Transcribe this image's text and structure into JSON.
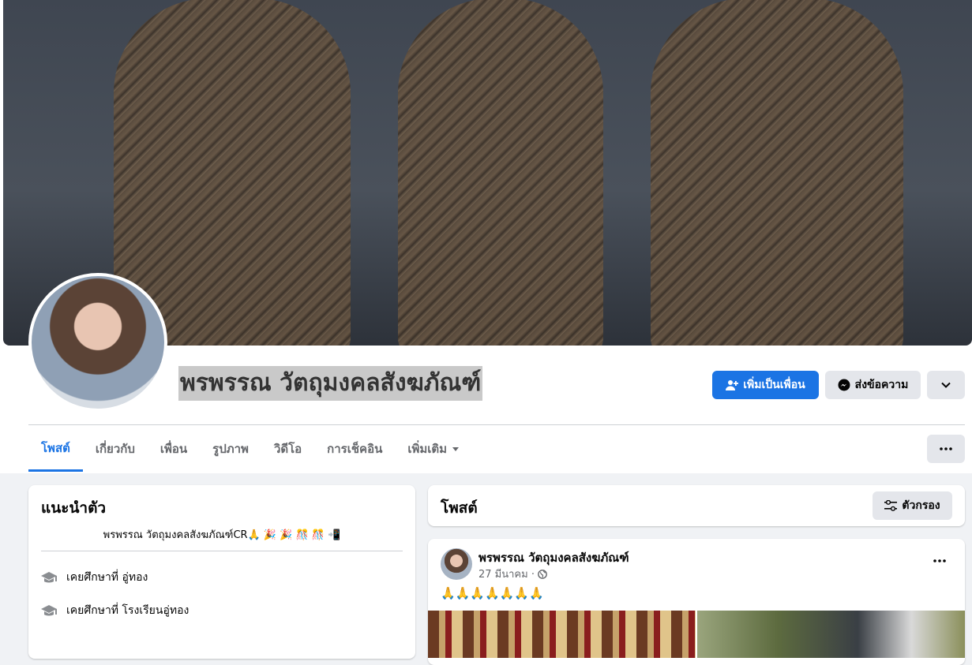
{
  "profile": {
    "name": "พรพรรณ วัตถุมงคลสังฆภัณฑ์"
  },
  "actions": {
    "add_friend": "เพิ่มเป็นเพื่อน",
    "message": "ส่งข้อความ"
  },
  "tabs": [
    {
      "label": "โพสต์",
      "active": true
    },
    {
      "label": "เกี่ยวกับ"
    },
    {
      "label": "เพื่อน"
    },
    {
      "label": "รูปภาพ"
    },
    {
      "label": "วิดีโอ"
    },
    {
      "label": "การเช็คอิน"
    },
    {
      "label": "เพิ่มเติม"
    }
  ],
  "intro": {
    "title": "แนะนำตัว",
    "bio": "พรพรรณ วัตถุมงคลสังฆภัณฑ์CR🙏 🎉 🎉 🎊 🎊 📲",
    "items": [
      {
        "icon": "graduation-cap-icon",
        "text": "เคยศึกษาที่ อู่ทอง"
      },
      {
        "icon": "graduation-cap-icon",
        "text": "เคยศึกษาที่ โรงเรียนอู่ทอง"
      }
    ]
  },
  "posts_section": {
    "title": "โพสต์",
    "filter_label": "ตัวกรอง"
  },
  "post": {
    "author": "พรพรรณ วัตถุมงคลสังฆภัณฑ์",
    "date": "27 มีนาคม ·",
    "text": "🙏🙏🙏🙏🙏🙏🙏"
  },
  "colors": {
    "accent": "#1b74e4",
    "page_bg": "#f0f2f5",
    "secondary_button": "#e4e6eb"
  }
}
